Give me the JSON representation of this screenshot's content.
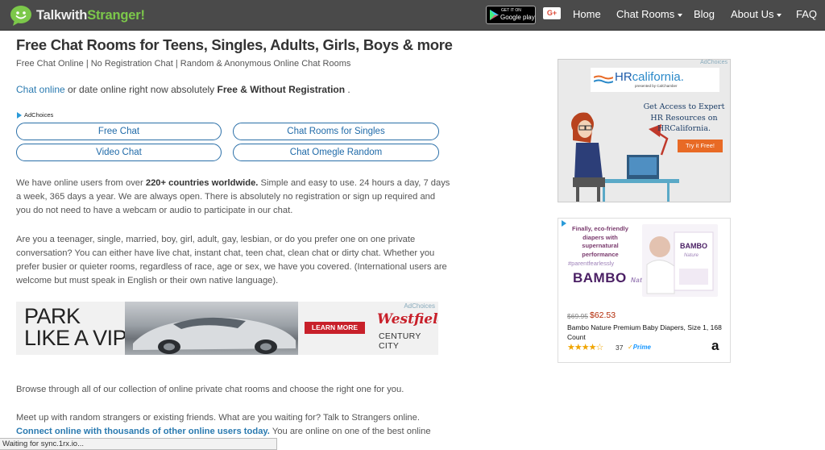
{
  "navbar": {
    "brand_prefix": "Talkwith",
    "brand_accent": "Stranger!",
    "google_play_small": "GET IT ON",
    "google_play_big": "Google play",
    "gplus_label": "G+",
    "links": {
      "home": "Home",
      "chat_rooms": "Chat Rooms",
      "blog": "Blog",
      "about_us": "About Us",
      "faq": "FAQ"
    }
  },
  "main": {
    "title": "Free Chat Rooms for Teens, Singles, Adults, Girls, Boys & more",
    "subtitle": "Free Chat Online | No Registration Chat | Random & Anonymous Online Chat Rooms",
    "intro": {
      "link": "Chat online",
      "text": " or date online right now absolutely ",
      "bold": "Free & Without Registration",
      "end": " ."
    },
    "adchoices_label": "AdChoices",
    "buttons": {
      "free_chat": "Free Chat",
      "chat_rooms_singles": "Chat Rooms for Singles",
      "video_chat": "Video Chat",
      "chat_omegle_random": "Chat Omegle Random"
    },
    "para1": {
      "pre": "We have online users from over ",
      "bold": "220+ countries worldwide.",
      "post": " Simple and easy to use. 24 hours a day, 7 days a week, 365 days a year. We are always open. There is absolutely no registration or sign up required and you do not need to have a webcam or audio to participate in our chat."
    },
    "para2": "Are you a teenager, single, married, boy, girl, adult, gay, lesbian, or do you prefer one on one private conversation? You can either have live chat, instant chat, teen chat, clean chat or dirty chat. Whether you prefer busier or quieter rooms, regardless of race, age or sex, we have you covered. (International users are welcome but must speak in English or their own native language).",
    "para3": "Browse through all of our collection of online private chat rooms and choose the right one for you.",
    "para4": {
      "text": "Meet up with random strangers or existing friends. What are you waiting for? Talk to Strangers online.",
      "link": "Connect online with thousands of other online users today.",
      "post": " You are online on one of the best online"
    }
  },
  "banner_ad": {
    "line1": "PARK",
    "line2": "LIKE A VIP",
    "cta": "LEARN MORE",
    "brand": "Westfield",
    "location": "CENTURY CITY",
    "adchoices": "AdChoices"
  },
  "side_ad_hr": {
    "adchoices": "AdChoices",
    "logo_main": "HR",
    "logo_accent": "california.",
    "logo_sub": "presented by CalChamber",
    "body": "Get Access to Expert HR Resources on HRCalifornia.",
    "cta": "Try it Free!"
  },
  "side_ad_bambo": {
    "slogan": "Finally, eco-friendly diapers with supernatural performance",
    "hashtag": "#parentfearlessly",
    "brand": "BAMBO",
    "brand_sub": "Nature",
    "price_old": "$69.95",
    "price_new": "$62.53",
    "product_name": "Bambo Nature Premium Baby Diapers, Size 1, 168 Count",
    "stars": "★★★★☆",
    "reviews": "37",
    "prime": "Prime",
    "amazon": "a"
  },
  "status": "Waiting for sync.1rx.io..."
}
